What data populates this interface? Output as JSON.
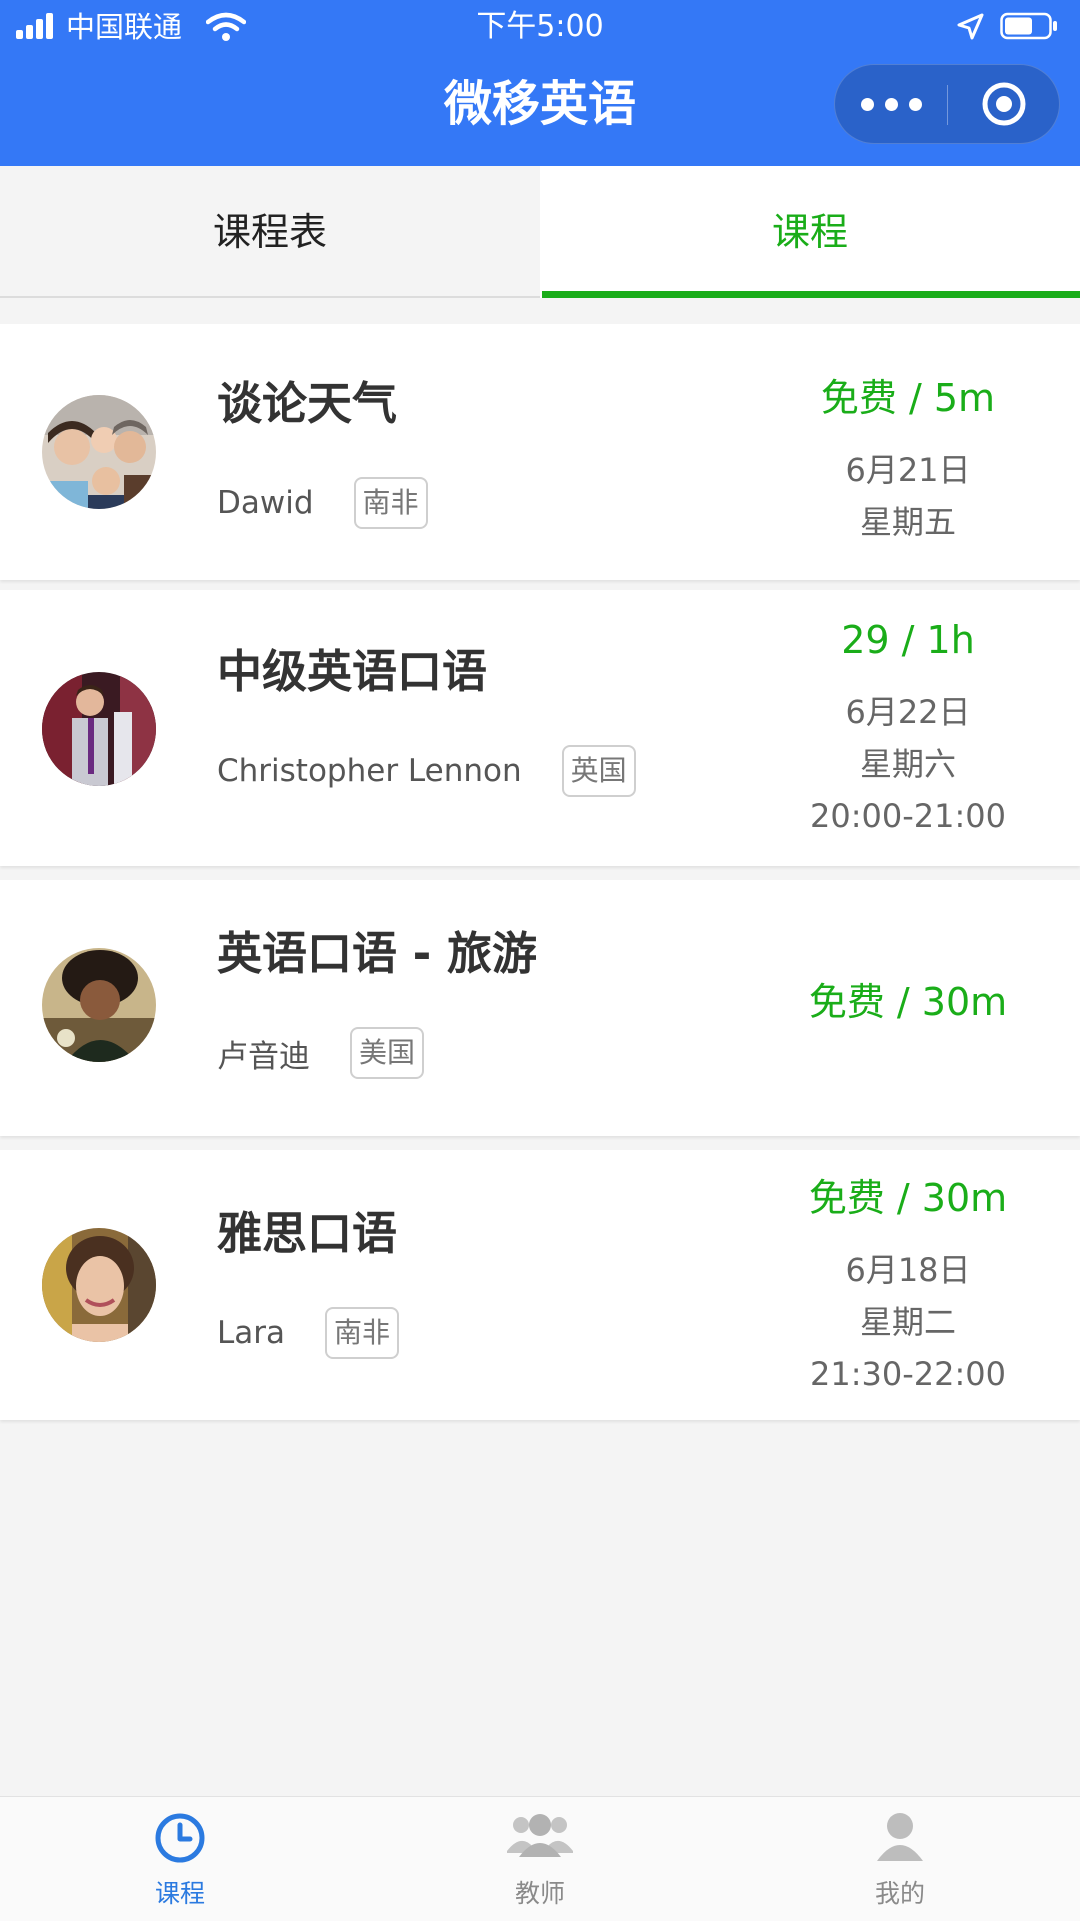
{
  "status_bar": {
    "carrier": "中国联通",
    "time": "下午5:00",
    "icons": [
      "signal-icon",
      "wifi-icon",
      "location-icon",
      "battery-icon"
    ]
  },
  "nav": {
    "title": "微移英语",
    "capsule_icons": [
      "more-icon",
      "close-icon"
    ]
  },
  "tabs": [
    {
      "label": "课程表",
      "active": false
    },
    {
      "label": "课程",
      "active": true
    }
  ],
  "courses": [
    {
      "title": "谈论天气",
      "teacher": "Dawid",
      "country": "南非",
      "price": "免费 / 5m",
      "date": "6月21日",
      "weekday": "星期五",
      "time": ""
    },
    {
      "title": "中级英语口语",
      "teacher": "Christopher Lennon",
      "country": "英国",
      "price": "29 / 1h",
      "date": "6月22日",
      "weekday": "星期六",
      "time": "20:00-21:00"
    },
    {
      "title": "英语口语 - 旅游",
      "teacher": "卢音迪",
      "country": "美国",
      "price": "免费 / 30m",
      "date": "",
      "weekday": "",
      "time": ""
    },
    {
      "title": "雅思口语",
      "teacher": "Lara",
      "country": "南非",
      "price": "免费 / 30m",
      "date": "6月18日",
      "weekday": "星期二",
      "time": "21:30-22:00"
    }
  ],
  "tab_bar": [
    {
      "label": "课程",
      "icon": "clock-icon",
      "active": true
    },
    {
      "label": "教师",
      "icon": "teachers-icon",
      "active": false
    },
    {
      "label": "我的",
      "icon": "user-icon",
      "active": false
    }
  ],
  "colors": {
    "header_blue": "#3478f6",
    "accent_green": "#1aad19",
    "tabbar_active_blue": "#2b7ae0",
    "background": "#f4f4f4"
  }
}
